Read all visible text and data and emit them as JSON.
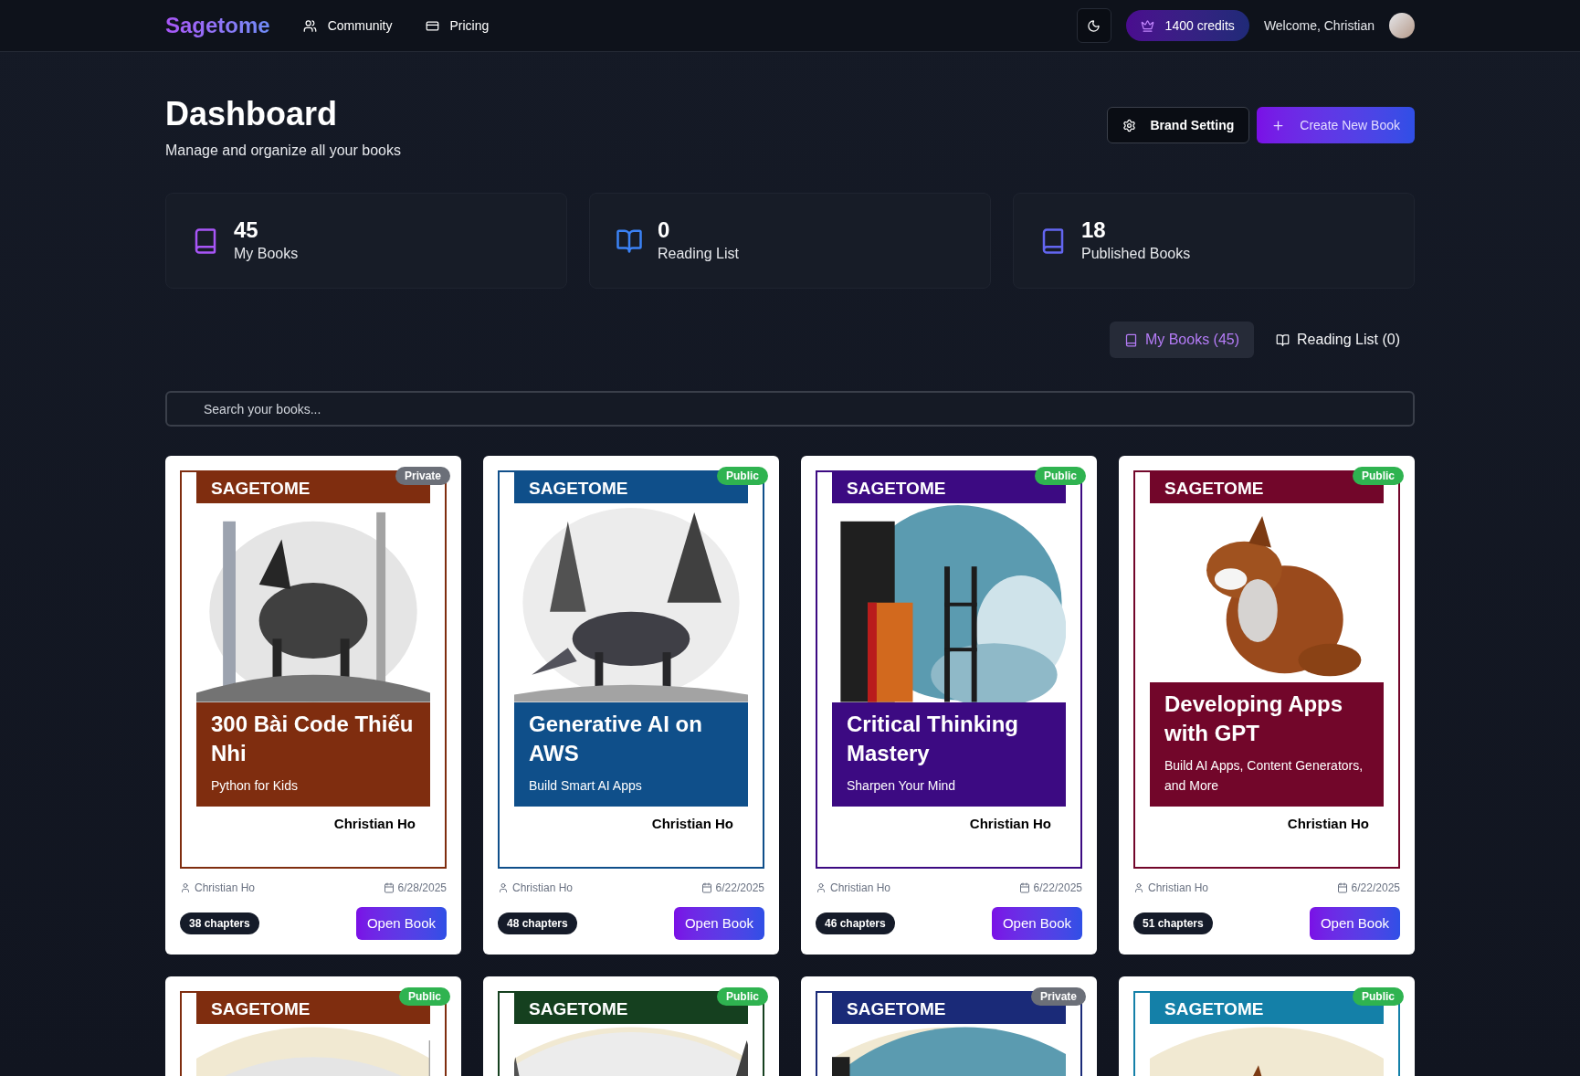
{
  "header": {
    "logo": "Sagetome",
    "nav": [
      {
        "label": "Community"
      },
      {
        "label": "Pricing"
      }
    ],
    "credits": "1400 credits",
    "welcome": "Welcome, Christian"
  },
  "page": {
    "title": "Dashboard",
    "subtitle": "Manage and organize all your books",
    "actions": [
      {
        "label": "Brand Setting",
        "kind": "secondary"
      },
      {
        "label": "Create New Book",
        "kind": "primary"
      }
    ]
  },
  "stats": [
    {
      "value": "45",
      "label": "My Books",
      "color": "#a855f7"
    },
    {
      "value": "0",
      "label": "Reading List",
      "color": "#3b82f6"
    },
    {
      "value": "18",
      "label": "Published Books",
      "color": "#6366f1"
    }
  ],
  "tabs": [
    {
      "label": "My Books (45)",
      "selected": true
    },
    {
      "label": "Reading List (0)",
      "selected": false
    }
  ],
  "search": {
    "placeholder": "Search your books..."
  },
  "books": [
    {
      "brand": "SAGETOME",
      "color": "#7f2d0f",
      "visibility": "Private",
      "public": false,
      "title": "300 Bài Code Thiếu Nhi",
      "subtitle": "Python for Kids",
      "cover_author": "Christian Ho",
      "author": "Christian Ho",
      "date": "6/28/2025",
      "chapters": "38 chapters",
      "button": "Open Book"
    },
    {
      "brand": "SAGETOME",
      "color": "#0f4f8a",
      "visibility": "Public",
      "public": true,
      "title": "Generative AI on AWS",
      "subtitle": "Build Smart AI Apps",
      "cover_author": "Christian Ho",
      "author": "Christian Ho",
      "date": "6/22/2025",
      "chapters": "48 chapters",
      "button": "Open Book"
    },
    {
      "brand": "SAGETOME",
      "color": "#3c0a82",
      "visibility": "Public",
      "public": true,
      "title": "Critical Thinking Mastery",
      "subtitle": "Sharpen Your Mind",
      "cover_author": "Christian Ho",
      "author": "Christian Ho",
      "date": "6/22/2025",
      "chapters": "46 chapters",
      "button": "Open Book"
    },
    {
      "brand": "SAGETOME",
      "color": "#72062a",
      "visibility": "Public",
      "public": true,
      "title": "Developing Apps with GPT",
      "subtitle": "Build AI Apps, Content Generators, and More",
      "cover_author": "Christian Ho",
      "author": "Christian Ho",
      "date": "6/22/2025",
      "chapters": "51 chapters",
      "button": "Open Book"
    },
    {
      "brand": "SAGETOME",
      "color": "#7f2d0f",
      "visibility": "Public",
      "public": true
    },
    {
      "brand": "SAGETOME",
      "color": "#15401f",
      "visibility": "Public",
      "public": true
    },
    {
      "brand": "SAGETOME",
      "color": "#1a2a78",
      "visibility": "Private",
      "public": false
    },
    {
      "brand": "SAGETOME",
      "color": "#1480a8",
      "visibility": "Public",
      "public": true
    }
  ]
}
